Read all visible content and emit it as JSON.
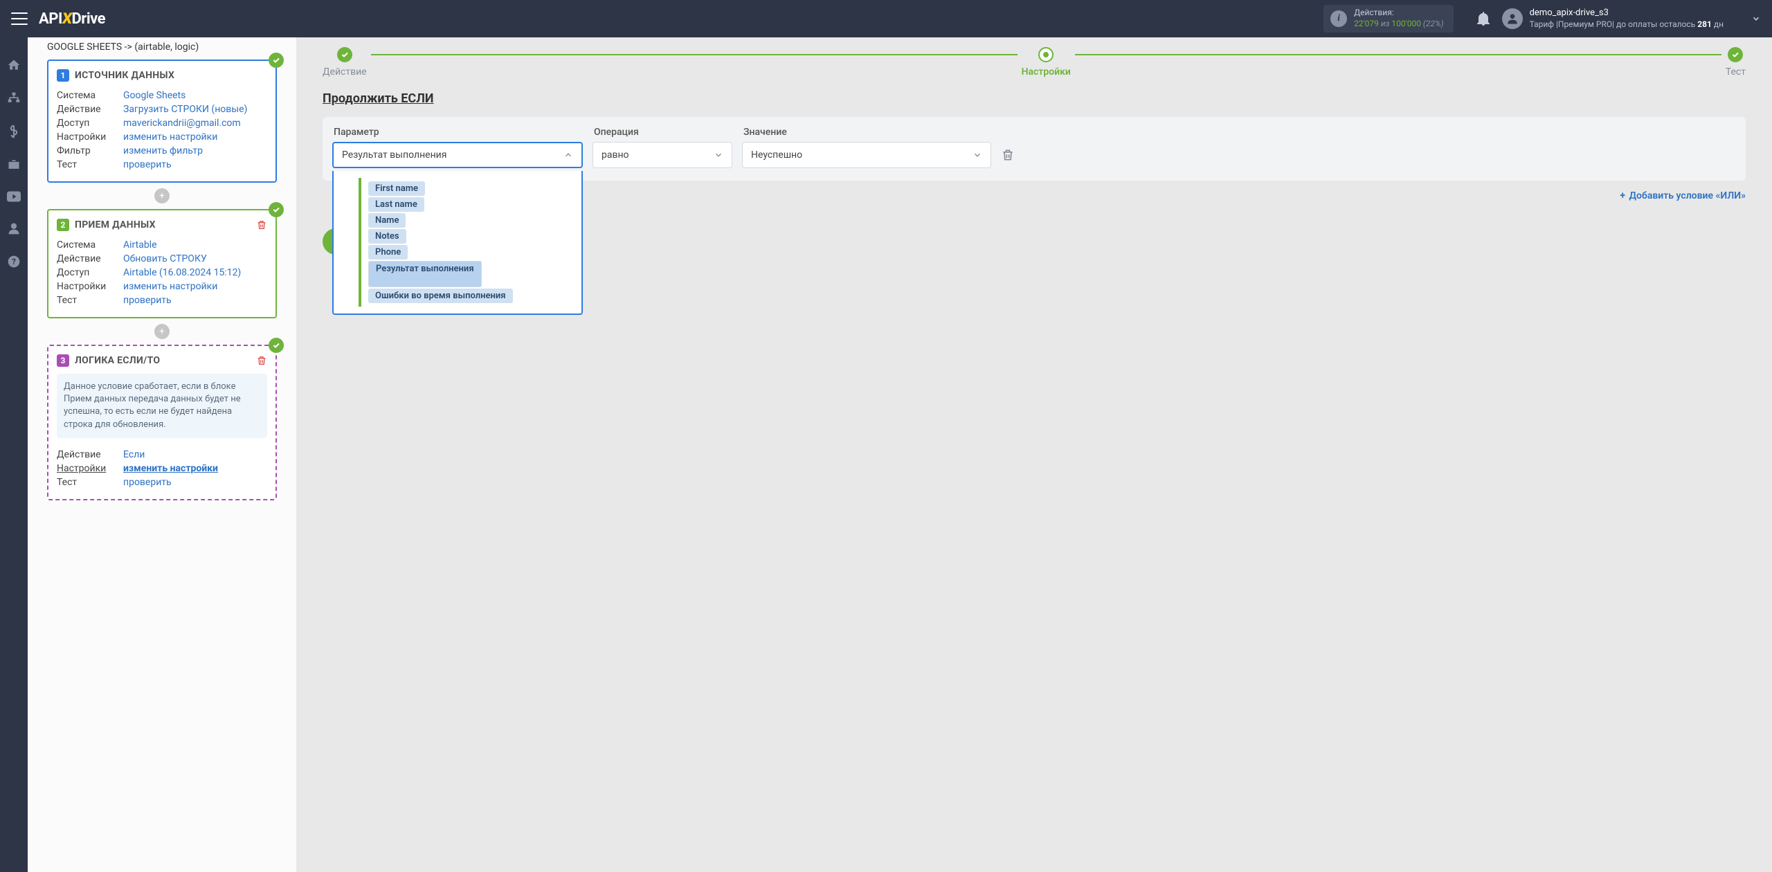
{
  "topbar": {
    "logo_pre": "API",
    "logo_x": "X",
    "logo_post": "Drive",
    "actions_label": "Действия:",
    "actions_used": "22'079",
    "actions_sep": " из ",
    "actions_total": "100'000",
    "actions_pct": " (22%)",
    "username": "demo_apix-drive_s3",
    "tariff_pre": "Тариф  |Премиум PRO|  до оплаты осталось ",
    "tariff_days": "281",
    "tariff_post": " дн"
  },
  "left": {
    "scr_title": "GOOGLE SHEETS -> (airtable, logic)",
    "block1": {
      "num": "1",
      "title": "ИСТОЧНИК ДАННЫХ",
      "rows": [
        {
          "k": "Система",
          "v": "Google Sheets"
        },
        {
          "k": "Действие",
          "v": "Загрузить СТРОКИ (новые)"
        },
        {
          "k": "Доступ",
          "v": "maverickandrii@gmail.com"
        },
        {
          "k": "Настройки",
          "v": "изменить настройки"
        },
        {
          "k": "Фильтр",
          "v": "изменить фильтр"
        },
        {
          "k": "Тест",
          "v": "проверить"
        }
      ]
    },
    "block2": {
      "num": "2",
      "title": "ПРИЕМ ДАННЫХ",
      "rows": [
        {
          "k": "Система",
          "v": "Airtable"
        },
        {
          "k": "Действие",
          "v": "Обновить СТРОКУ"
        },
        {
          "k": "Доступ",
          "v": "Airtable (16.08.2024 15:12)"
        },
        {
          "k": "Настройки",
          "v": "изменить настройки"
        },
        {
          "k": "Тест",
          "v": "проверить"
        }
      ]
    },
    "block3": {
      "num": "3",
      "title": "ЛОГИКА ЕСЛИ/ТО",
      "note": "Данное условие сработает, если в блоке Прием данных передача данных будет не успешна, то есть если не будет найдена строка для обновления.",
      "rows": [
        {
          "k": "Действие",
          "v": "Если"
        },
        {
          "k": "Настройки",
          "v": "изменить настройки",
          "hl": true
        },
        {
          "k": "Тест",
          "v": "проверить"
        }
      ]
    }
  },
  "right": {
    "steps": [
      "Действие",
      "Настройки",
      "Тест"
    ],
    "section_title": "Продолжить ЕСЛИ",
    "labels": {
      "param": "Параметр",
      "op": "Операция",
      "val": "Значение"
    },
    "param_value": "Результат выполнения",
    "op_value": "равно",
    "val_value": "Неуспешно",
    "dropdown": [
      "First name",
      "Last name",
      "Name",
      "Notes",
      "Phone",
      "Результат выполнения",
      "Ошибки во время выполнения"
    ],
    "dd_selected_index": 5,
    "add_or": "Добавить условие «ИЛИ»"
  }
}
